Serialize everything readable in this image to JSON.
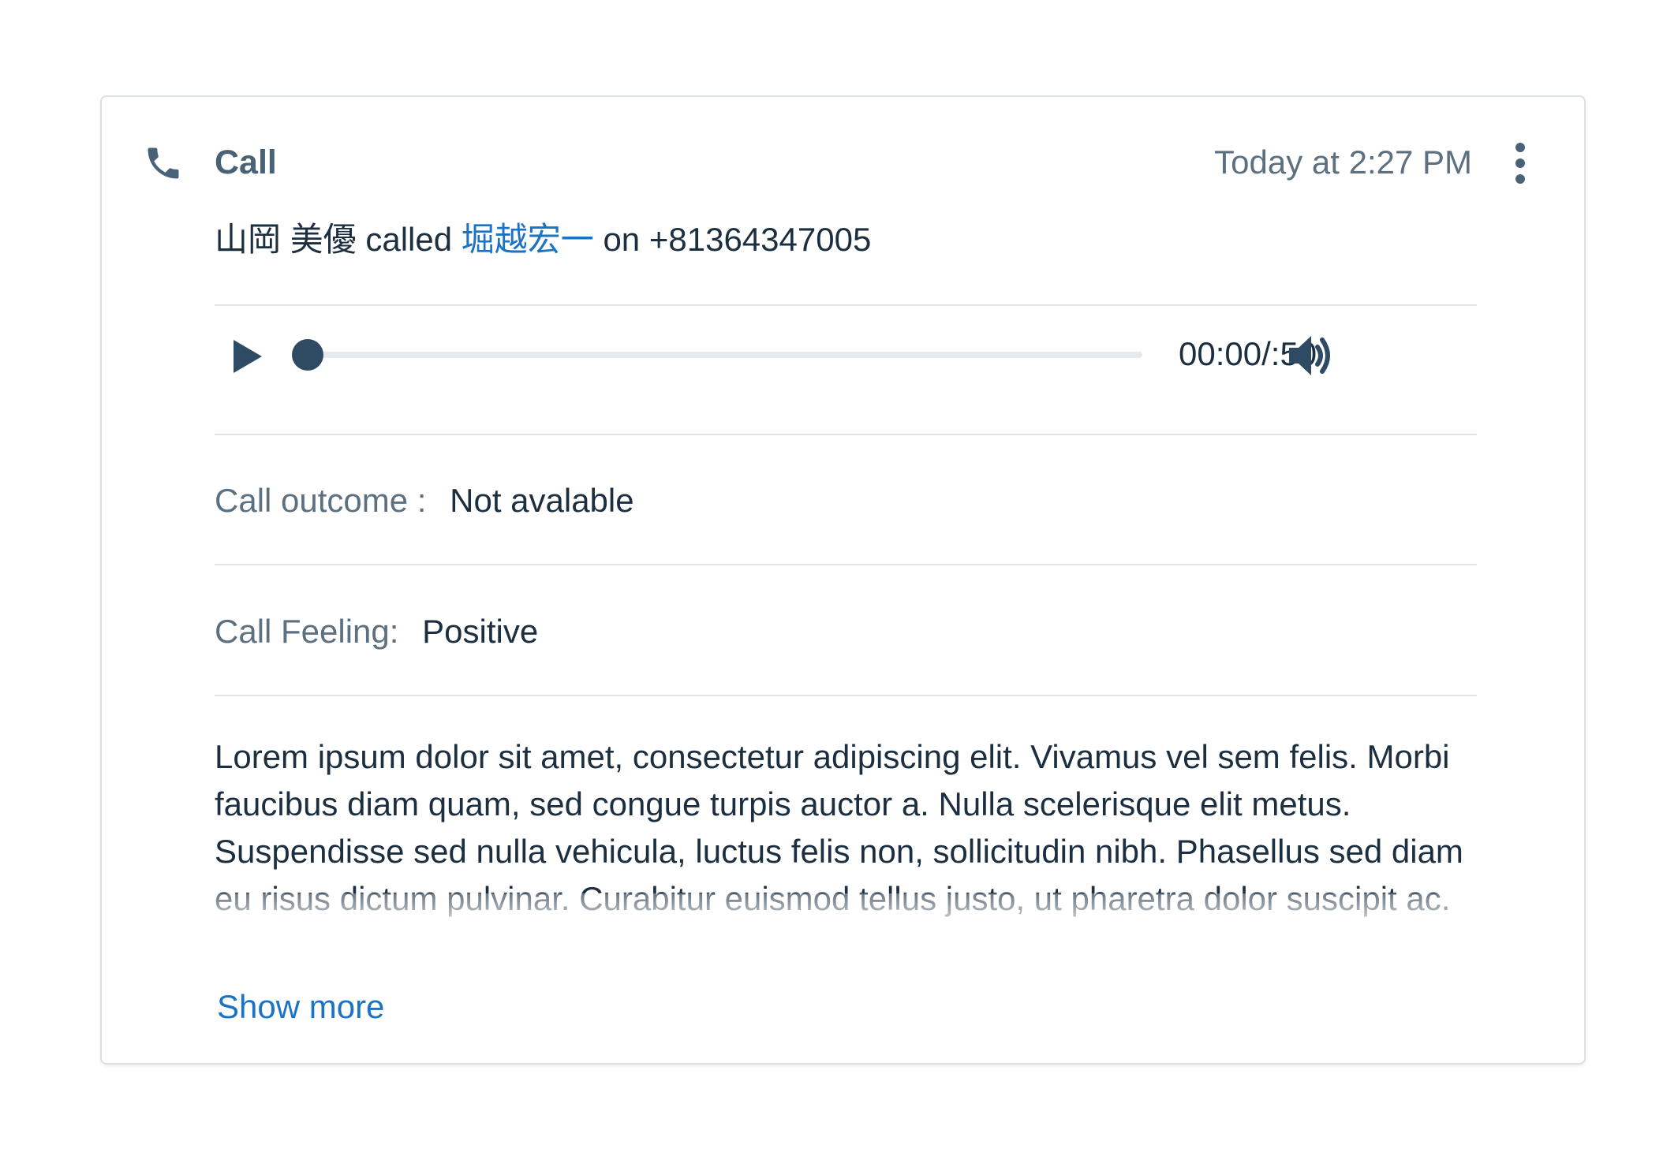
{
  "activity": {
    "type_label": "Call",
    "timestamp": "Today at 2:27 PM",
    "icons": {
      "type": "phone-icon",
      "menu": "more-vertical-icon",
      "play": "play-icon",
      "volume": "volume-icon"
    },
    "summary": {
      "caller": "山岡 美優",
      "verb": "called",
      "callee": "堀越宏一",
      "preposition": "on",
      "phone": "+81364347005"
    }
  },
  "player": {
    "time": "00:00/:50",
    "progress": 0
  },
  "fields": {
    "outcome_label": "Call outcome :",
    "outcome_value": "Not avalable",
    "feeling_label": "Call Feeling:",
    "feeling_value": "Positive"
  },
  "notes": {
    "text": "Lorem ipsum dolor sit amet, consectetur adipiscing elit. Vivamus vel sem felis. Morbi faucibus diam quam, sed congue turpis auctor a. Nulla scelerisque elit metus. Suspendisse sed nulla vehicula, luctus felis non, sollicitudin nibh. Phasellus sed diam eu risus dictum pulvinar. Curabitur euismod tellus justo, ut pharetra dolor suscipit ac. Morbi sed justo mi. Integer ultrices leo sed lectus dignissim, quis gravida nulla lacinia.",
    "show_more_label": "Show more"
  },
  "colors": {
    "accent_link": "#1a73c7",
    "icon_dark": "#2f4b63",
    "muted_text": "#5c7080",
    "divider": "#dfe5ea"
  }
}
